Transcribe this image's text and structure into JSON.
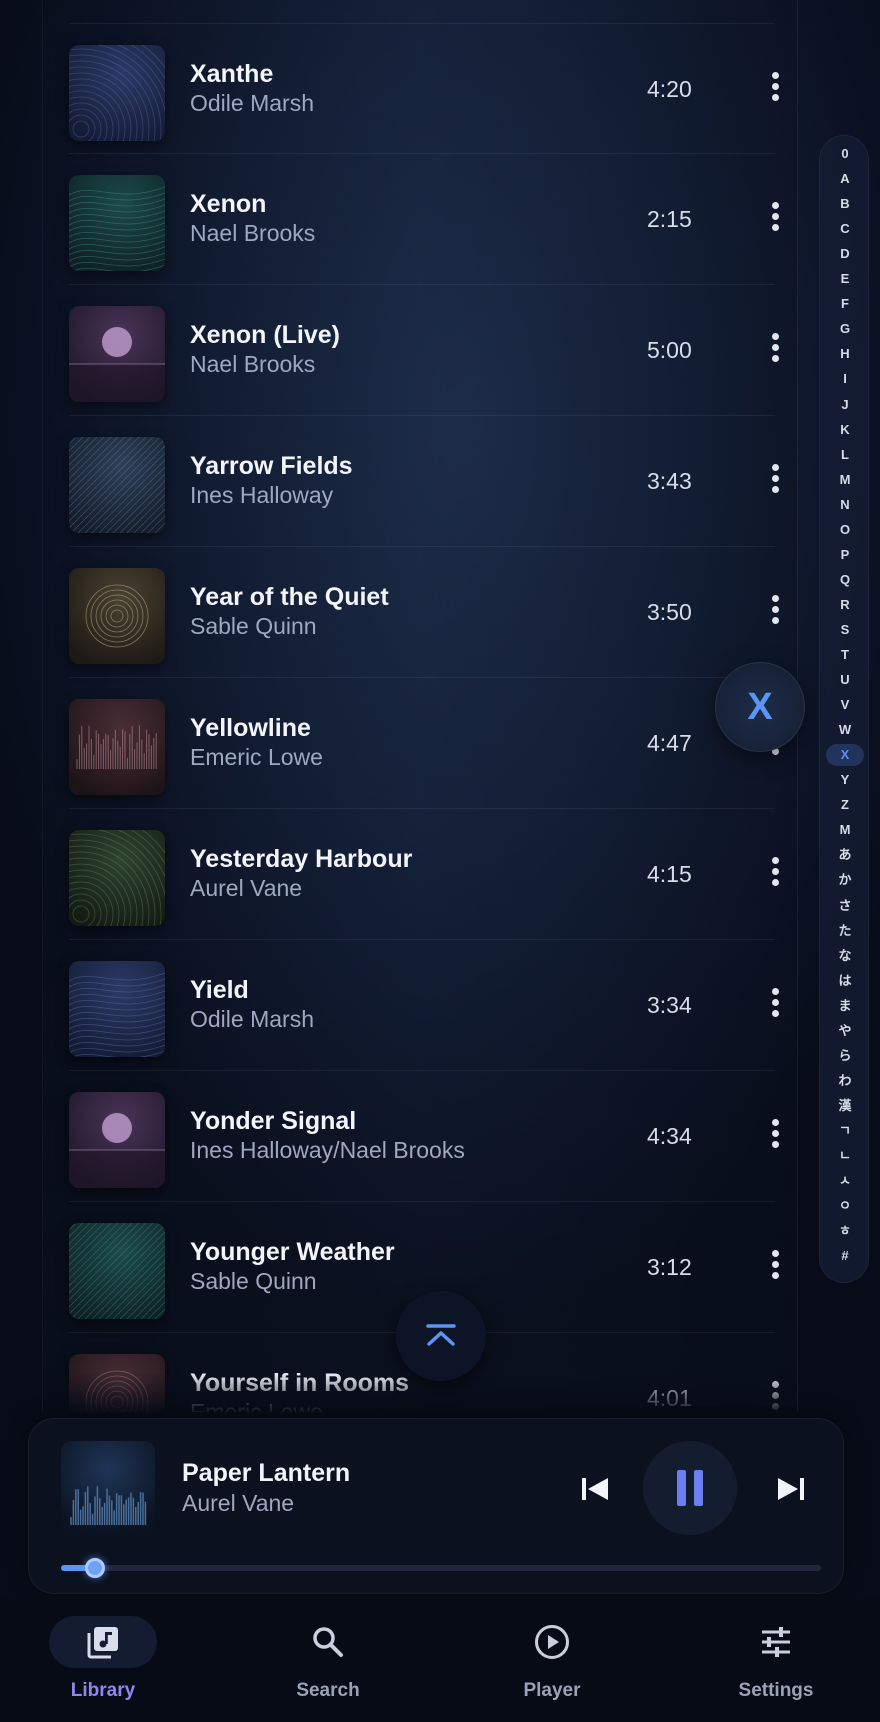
{
  "alpha_index": {
    "letters": [
      "0",
      "A",
      "B",
      "C",
      "D",
      "E",
      "F",
      "G",
      "H",
      "I",
      "J",
      "K",
      "L",
      "M",
      "N",
      "O",
      "P",
      "Q",
      "R",
      "S",
      "T",
      "U",
      "V",
      "W",
      "X",
      "Y",
      "Z",
      "M",
      "あ",
      "か",
      "さ",
      "た",
      "な",
      "は",
      "ま",
      "や",
      "ら",
      "わ",
      "漢",
      "ㄱ",
      "ㄴ",
      "ㅅ",
      "ㅇ",
      "ㅎ",
      "#"
    ],
    "active": "X"
  },
  "bubble": {
    "letter": "X"
  },
  "tracks": [
    {
      "title": "Xanthe",
      "artist": "Odile Marsh",
      "duration": "4:20",
      "art": "rings-blue"
    },
    {
      "title": "Xenon",
      "artist": "Nael Brooks",
      "duration": "2:15",
      "art": "waves-teal"
    },
    {
      "title": "Xenon (Live)",
      "artist": "Nael Brooks",
      "duration": "5:00",
      "art": "moon-purple"
    },
    {
      "title": "Yarrow Fields",
      "artist": "Ines Halloway",
      "duration": "3:43",
      "art": "lines-slate"
    },
    {
      "title": "Year of the Quiet",
      "artist": "Sable Quinn",
      "duration": "3:50",
      "art": "circles-bronze"
    },
    {
      "title": "Yellowline",
      "artist": "Emeric Lowe",
      "duration": "4:47",
      "art": "bars-rose"
    },
    {
      "title": "Yesterday Harbour",
      "artist": "Aurel Vane",
      "duration": "4:15",
      "art": "rings-green"
    },
    {
      "title": "Yield",
      "artist": "Odile Marsh",
      "duration": "3:34",
      "art": "waves-blue"
    },
    {
      "title": "Yonder Signal",
      "artist": "Ines Halloway/Nael Brooks",
      "duration": "4:34",
      "art": "moon-purple"
    },
    {
      "title": "Younger Weather",
      "artist": "Sable Quinn",
      "duration": "3:12",
      "art": "lines-teal"
    },
    {
      "title": "Yourself in Rooms",
      "artist": "Emeric Lowe",
      "duration": "4:01",
      "art": "circles-rose"
    }
  ],
  "now_playing": {
    "title": "Paper Lantern",
    "artist": "Aurel Vane",
    "progress": 0.045,
    "state": "playing"
  },
  "nav": {
    "items": [
      {
        "label": "Library",
        "icon": "library-music-icon",
        "active": true
      },
      {
        "label": "Search",
        "icon": "search-icon",
        "active": false
      },
      {
        "label": "Player",
        "icon": "play-circle-icon",
        "active": false
      },
      {
        "label": "Settings",
        "icon": "sliders-icon",
        "active": false
      }
    ]
  },
  "colors": {
    "accent": "#5b95f5",
    "nav_active": "#8f86f2",
    "background": "#0b1224"
  }
}
